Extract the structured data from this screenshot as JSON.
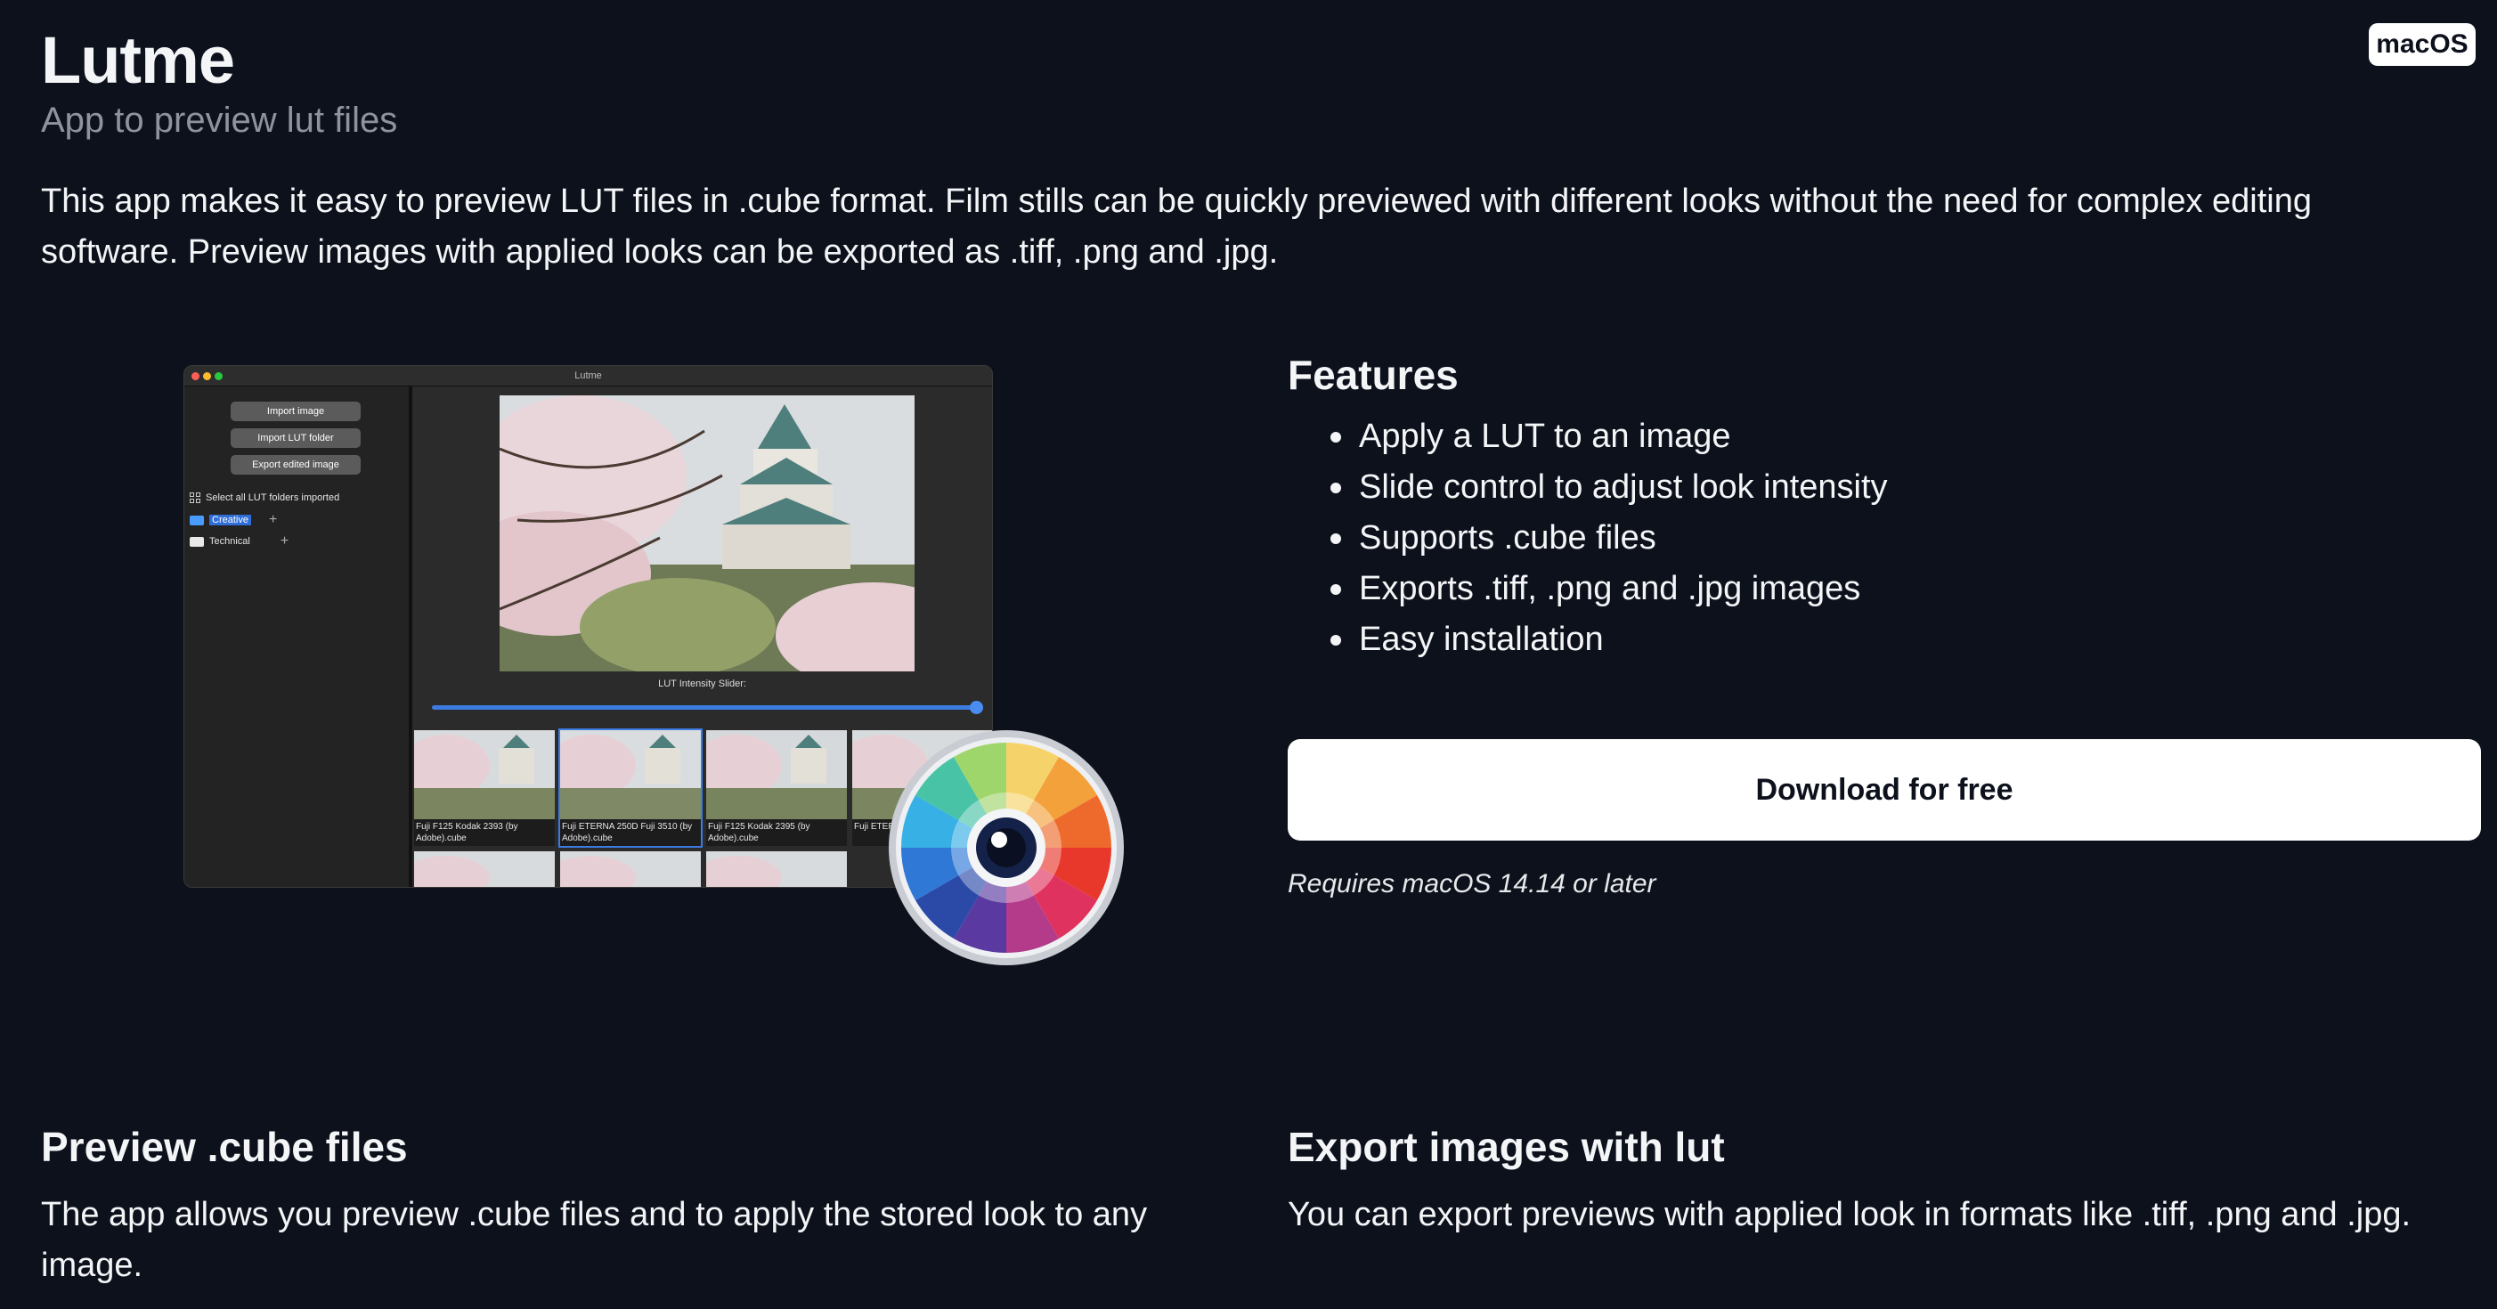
{
  "header": {
    "title": "Lutme",
    "subtitle": "App to preview lut files",
    "platform_badge": "macOS"
  },
  "intro": "This app makes it easy to preview LUT files in .cube format. Film stills can be quickly previewed with different looks without the need for complex editing software. Preview images with applied looks can be exported as .tiff, .png and .jpg.",
  "app_screenshot": {
    "window_title": "Lutme",
    "buttons": [
      "Import image",
      "Import LUT folder",
      "Export edited image"
    ],
    "select_all_label": "Select all LUT folders imported",
    "folders": [
      {
        "name": "Creative",
        "selected": true
      },
      {
        "name": "Technical",
        "selected": false
      }
    ],
    "slider_label": "LUT Intensity Slider:",
    "slider_value_pct": 100,
    "thumbnails": [
      {
        "label": "Fuji F125 Kodak 2393 (by Adobe).cube"
      },
      {
        "label": "Fuji ETERNA 250D Fuji 3510 (by Adobe).cube",
        "selected": true
      },
      {
        "label": "Fuji F125 Kodak 2395 (by Adobe).cube"
      },
      {
        "label": "Fuji ETERNA 2395 (by"
      }
    ]
  },
  "features": {
    "title": "Features",
    "items": [
      "Apply a LUT to an image",
      "Slide control to adjust look intensity",
      "Supports .cube files",
      "Exports .tiff, .png and .jpg images",
      "Easy installation"
    ]
  },
  "download": {
    "label": "Download for free",
    "requirement": "Requires macOS 14.14 or later"
  },
  "sections": [
    {
      "title": "Preview .cube files",
      "text": "The app allows you preview .cube files and to apply the stored look to any image."
    },
    {
      "title": "Export images with lut",
      "text": "You can export previews with applied look in formats like .tiff, .png and .jpg."
    }
  ],
  "colors": {
    "background": "#0c111c",
    "text": "#f4f5f7",
    "muted": "#8f949c",
    "accent": "#3c7be0"
  },
  "icons": [
    "app-icon-color-wheel",
    "grid-icon",
    "folder-icon",
    "plus-icon"
  ]
}
